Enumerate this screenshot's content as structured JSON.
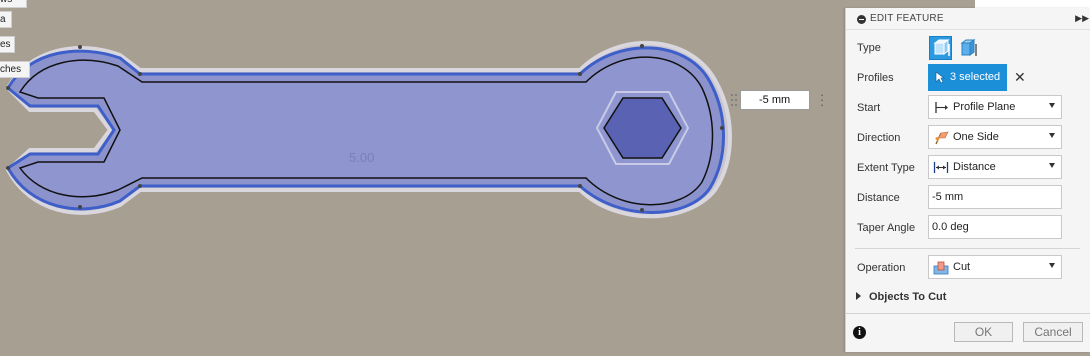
{
  "browser_tags": [
    "ws",
    "a",
    "es",
    "ches"
  ],
  "viewport": {
    "dimension_label": "5.00",
    "dimension_input_value": "-5 mm"
  },
  "panel": {
    "title": "EDIT FEATURE",
    "type_label": "Type",
    "profiles_label": "Profiles",
    "profiles_value": "3 selected",
    "start_label": "Start",
    "start_value": "Profile Plane",
    "direction_label": "Direction",
    "direction_value": "One Side",
    "extent_label": "Extent Type",
    "extent_value": "Distance",
    "distance_label": "Distance",
    "distance_value": "-5 mm",
    "taper_label": "Taper Angle",
    "taper_value": "0.0 deg",
    "operation_label": "Operation",
    "operation_value": "Cut",
    "objects_to_cut_label": "Objects To Cut",
    "ok_label": "OK",
    "cancel_label": "Cancel"
  },
  "icons": {
    "collapse": "collapse-circle-icon",
    "expand": "expand-panel-icon",
    "type_solid": "solid-extrude-icon",
    "type_surface": "surface-extrude-icon",
    "cursor": "select-cursor-icon",
    "clear": "clear-selection-icon",
    "start": "profile-plane-icon",
    "direction": "one-side-flag-icon",
    "extent": "distance-icon",
    "operation": "cut-icon",
    "info": "info-icon"
  },
  "colors": {
    "viewport_bg": "#a69f92",
    "profile_fill": "#8c93cc",
    "selected_blue": "#1c8fd9",
    "hex_fill": "#5a63b3"
  }
}
